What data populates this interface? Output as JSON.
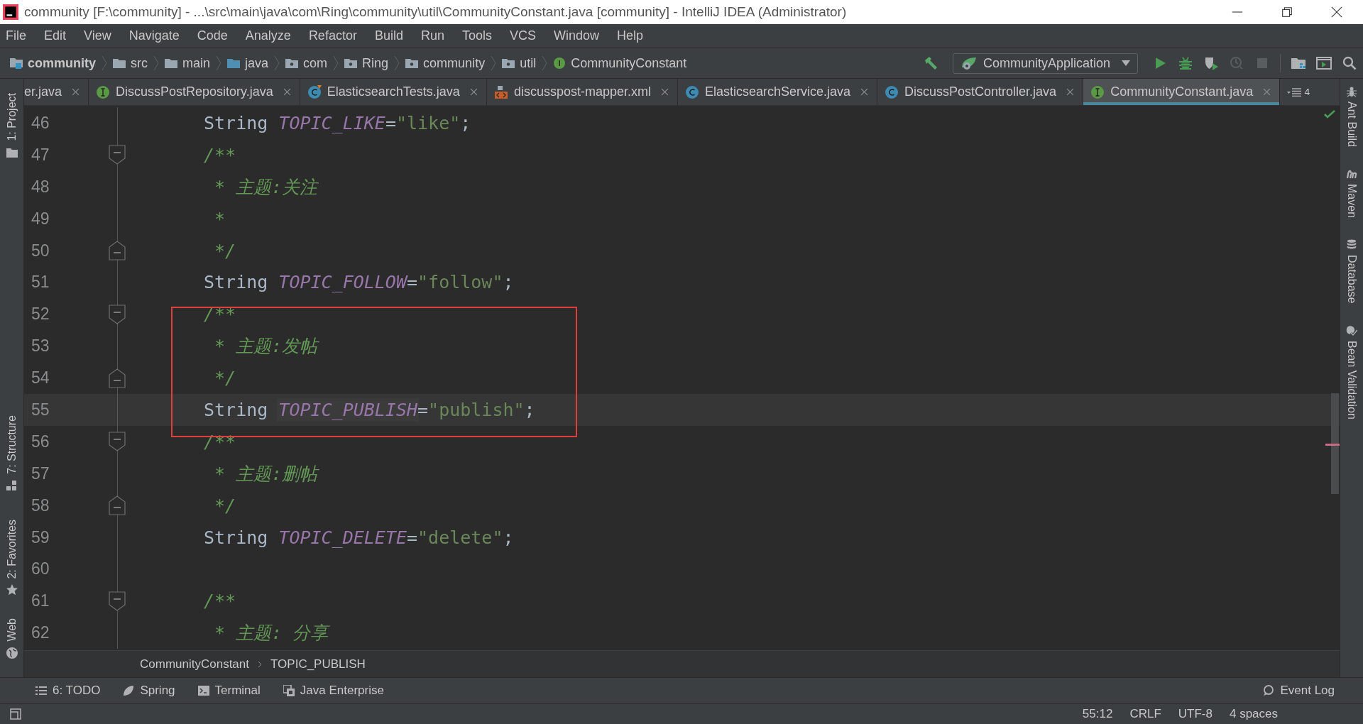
{
  "window": {
    "title": "community [F:\\community] - ...\\src\\main\\java\\com\\Ring\\community\\util\\CommunityConstant.java [community] - IntelliJ IDEA (Administrator)"
  },
  "menu": [
    "File",
    "Edit",
    "View",
    "Navigate",
    "Code",
    "Analyze",
    "Refactor",
    "Build",
    "Run",
    "Tools",
    "VCS",
    "Window",
    "Help"
  ],
  "nav_path": [
    {
      "label": "community",
      "kind": "project"
    },
    {
      "label": "src",
      "kind": "folder"
    },
    {
      "label": "main",
      "kind": "folder"
    },
    {
      "label": "java",
      "kind": "source"
    },
    {
      "label": "com",
      "kind": "package"
    },
    {
      "label": "Ring",
      "kind": "package"
    },
    {
      "label": "community",
      "kind": "package"
    },
    {
      "label": "util",
      "kind": "package"
    },
    {
      "label": "CommunityConstant",
      "kind": "interface"
    }
  ],
  "run_config": "CommunityApplication",
  "tabs": [
    {
      "label": "er.java",
      "kind": "plain",
      "selected": false
    },
    {
      "label": "DiscussPostRepository.java",
      "kind": "interface",
      "selected": false
    },
    {
      "label": "ElasticsearchTests.java",
      "kind": "test",
      "selected": false
    },
    {
      "label": "discusspost-mapper.xml",
      "kind": "xml",
      "selected": false
    },
    {
      "label": "ElasticsearchService.java",
      "kind": "class",
      "selected": false
    },
    {
      "label": "DiscussPostController.java",
      "kind": "class",
      "selected": false
    },
    {
      "label": "CommunityConstant.java",
      "kind": "interface",
      "selected": true
    }
  ],
  "tab_overflow": "4",
  "left_tools": [
    {
      "label": "1: Project",
      "kind": "project"
    },
    {
      "label": "7: Structure",
      "kind": "structure"
    },
    {
      "label": "2: Favorites",
      "kind": "favorites"
    },
    {
      "label": "Web",
      "kind": "web"
    }
  ],
  "right_tools": [
    {
      "label": "Ant Build",
      "kind": "ant"
    },
    {
      "label": "Maven",
      "kind": "maven"
    },
    {
      "label": "Database",
      "kind": "database"
    },
    {
      "label": "Bean Validation",
      "kind": "bean"
    }
  ],
  "lines": [
    {
      "number": "46",
      "fold_start": false,
      "fold_end": false,
      "current": false,
      "tokens": [
        {
          "kind": "keyword",
          "text": "String "
        },
        {
          "kind": "constant",
          "text": "TOPIC_LIKE"
        },
        {
          "kind": "plain",
          "text": "="
        },
        {
          "kind": "string",
          "text": "\"like\""
        },
        {
          "kind": "plain",
          "text": ";"
        }
      ]
    },
    {
      "number": "47",
      "fold_start": true,
      "fold_end": false,
      "current": false,
      "tokens": [
        {
          "kind": "comment",
          "text": "/**"
        }
      ]
    },
    {
      "number": "48",
      "fold_start": false,
      "fold_end": false,
      "current": false,
      "tokens": [
        {
          "kind": "comment",
          "text": " * 主题:关注"
        }
      ]
    },
    {
      "number": "49",
      "fold_start": false,
      "fold_end": false,
      "current": false,
      "tokens": [
        {
          "kind": "comment",
          "text": " *"
        }
      ]
    },
    {
      "number": "50",
      "fold_start": false,
      "fold_end": true,
      "current": false,
      "tokens": [
        {
          "kind": "comment",
          "text": " */"
        }
      ]
    },
    {
      "number": "51",
      "fold_start": false,
      "fold_end": false,
      "current": false,
      "tokens": [
        {
          "kind": "keyword",
          "text": "String "
        },
        {
          "kind": "constant",
          "text": "TOPIC_FOLLOW"
        },
        {
          "kind": "plain",
          "text": "="
        },
        {
          "kind": "string",
          "text": "\"follow\""
        },
        {
          "kind": "plain",
          "text": ";"
        }
      ]
    },
    {
      "number": "52",
      "fold_start": true,
      "fold_end": false,
      "current": false,
      "tokens": [
        {
          "kind": "comment",
          "text": "/**"
        }
      ]
    },
    {
      "number": "53",
      "fold_start": false,
      "fold_end": false,
      "current": false,
      "tokens": [
        {
          "kind": "comment",
          "text": " * 主题:发帖"
        }
      ]
    },
    {
      "number": "54",
      "fold_start": false,
      "fold_end": true,
      "current": false,
      "tokens": [
        {
          "kind": "comment",
          "text": " */"
        }
      ]
    },
    {
      "number": "55",
      "fold_start": false,
      "fold_end": false,
      "current": true,
      "tokens": [
        {
          "kind": "keyword",
          "text": "String "
        },
        {
          "kind": "constant-marked",
          "text": "TOPIC_PUBLISH"
        },
        {
          "kind": "plain",
          "text": "="
        },
        {
          "kind": "string",
          "text": "\"publish\""
        },
        {
          "kind": "plain",
          "text": ";"
        }
      ]
    },
    {
      "number": "56",
      "fold_start": true,
      "fold_end": false,
      "current": false,
      "tokens": [
        {
          "kind": "comment",
          "text": "/**"
        }
      ]
    },
    {
      "number": "57",
      "fold_start": false,
      "fold_end": false,
      "current": false,
      "tokens": [
        {
          "kind": "comment",
          "text": " * 主题:删帖"
        }
      ]
    },
    {
      "number": "58",
      "fold_start": false,
      "fold_end": true,
      "current": false,
      "tokens": [
        {
          "kind": "comment",
          "text": " */"
        }
      ]
    },
    {
      "number": "59",
      "fold_start": false,
      "fold_end": false,
      "current": false,
      "tokens": [
        {
          "kind": "keyword",
          "text": "String "
        },
        {
          "kind": "constant",
          "text": "TOPIC_DELETE"
        },
        {
          "kind": "plain",
          "text": "="
        },
        {
          "kind": "string",
          "text": "\"delete\""
        },
        {
          "kind": "plain",
          "text": ";"
        }
      ]
    },
    {
      "number": "60",
      "fold_start": false,
      "fold_end": false,
      "current": false
    },
    {
      "number": "61",
      "fold_start": true,
      "fold_end": false,
      "current": false,
      "tokens": [
        {
          "kind": "comment",
          "text": "/**"
        }
      ]
    },
    {
      "number": "62",
      "fold_start": false,
      "fold_end": false,
      "current": false,
      "tokens": [
        {
          "kind": "comment",
          "text": " * 主题: 分享"
        }
      ]
    }
  ],
  "code_breadcrumb": [
    "CommunityConstant",
    "TOPIC_PUBLISH"
  ],
  "bottom_tools": [
    {
      "label": "6: TODO",
      "kind": "todo"
    },
    {
      "label": "Spring",
      "kind": "spring"
    },
    {
      "label": "Terminal",
      "kind": "terminal"
    },
    {
      "label": "Java Enterprise",
      "kind": "enterprise"
    }
  ],
  "event_log": "Event Log",
  "status": [
    "55:12",
    "CRLF",
    "UTF-8",
    "4 spaces"
  ]
}
